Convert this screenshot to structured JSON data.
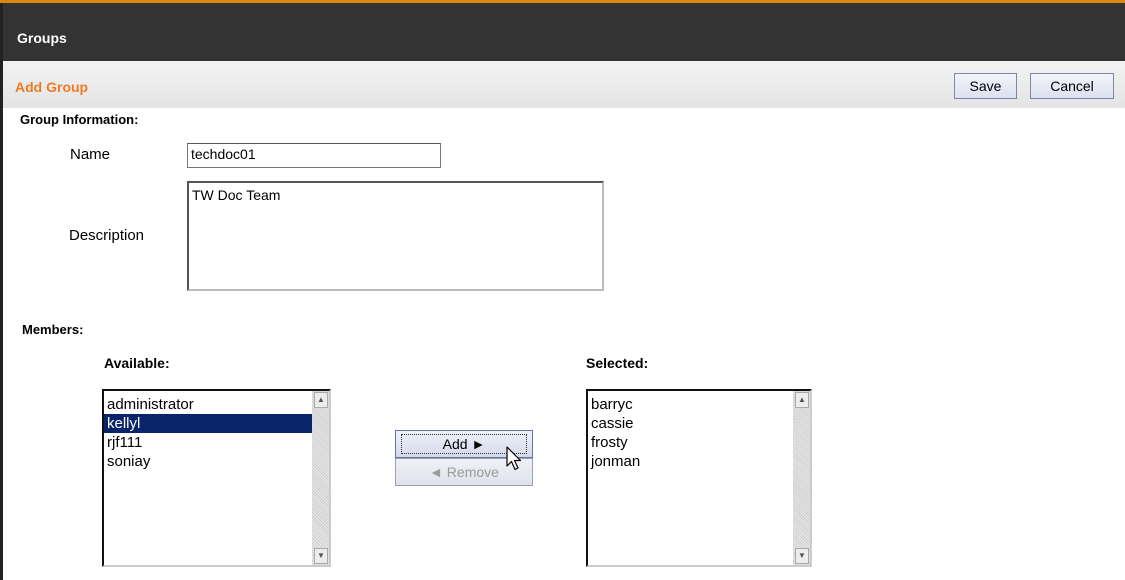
{
  "header": {
    "title": "Groups"
  },
  "subbar": {
    "title": "Add Group",
    "save_label": "Save",
    "cancel_label": "Cancel"
  },
  "group_info": {
    "section_label": "Group Information:",
    "name_label": "Name",
    "name_value": "techdoc01",
    "description_label": "Description",
    "description_value": "TW Doc Team"
  },
  "members": {
    "section_label": "Members:",
    "available_label": "Available:",
    "selected_label": "Selected:",
    "available": [
      "administrator",
      "kellyl",
      "rjf111",
      "soniay"
    ],
    "available_selected_index": 1,
    "selected": [
      "barryc",
      "cassie",
      "frosty",
      "jonman"
    ],
    "add_label": "Add ►",
    "remove_label": "◄ Remove"
  },
  "colors": {
    "accent": "#f07a23",
    "header_bg": "#333333",
    "top_line": "#d9890e",
    "selection": "#0a246a"
  }
}
